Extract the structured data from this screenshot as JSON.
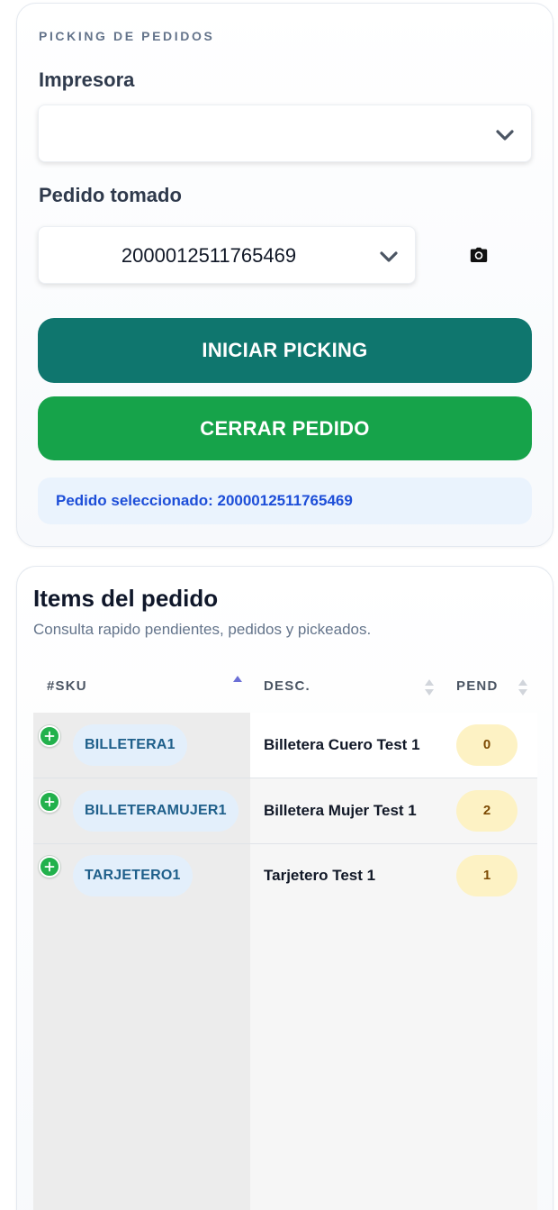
{
  "picking": {
    "section_title": "PICKING DE PEDIDOS",
    "printer_label": "Impresora",
    "printer_value": "",
    "order_label": "Pedido tomado",
    "order_value": "2000012511765469",
    "start_button": "INICIAR PICKING",
    "close_button": "CERRAR PEDIDO",
    "selected_info": "Pedido seleccionado: 2000012511765469"
  },
  "items": {
    "title": "Items del pedido",
    "subtitle": "Consulta rapido pendientes, pedidos y pickeados.",
    "columns": {
      "sku": "#SKU",
      "desc": "DESC.",
      "pend": "PEND"
    },
    "rows": [
      {
        "sku": "BILLETERA1",
        "desc": "Billetera Cuero Test 1",
        "pend": "0"
      },
      {
        "sku": "BILLETERAMUJER1",
        "desc": "Billetera Mujer Test 1",
        "pend": "2"
      },
      {
        "sku": "TARJETERO1",
        "desc": "Tarjetero Test 1",
        "pend": "1"
      }
    ]
  },
  "colors": {
    "primary_button": "#0f766e",
    "success_button": "#16a34a",
    "info_text": "#1d4ed8",
    "pending_badge": "#fdf2c4"
  },
  "icons": {
    "select_arrow": "chevron-down-icon",
    "scan": "camera-icon",
    "add_row": "plus-circle-icon",
    "sort": "sort-icon"
  }
}
